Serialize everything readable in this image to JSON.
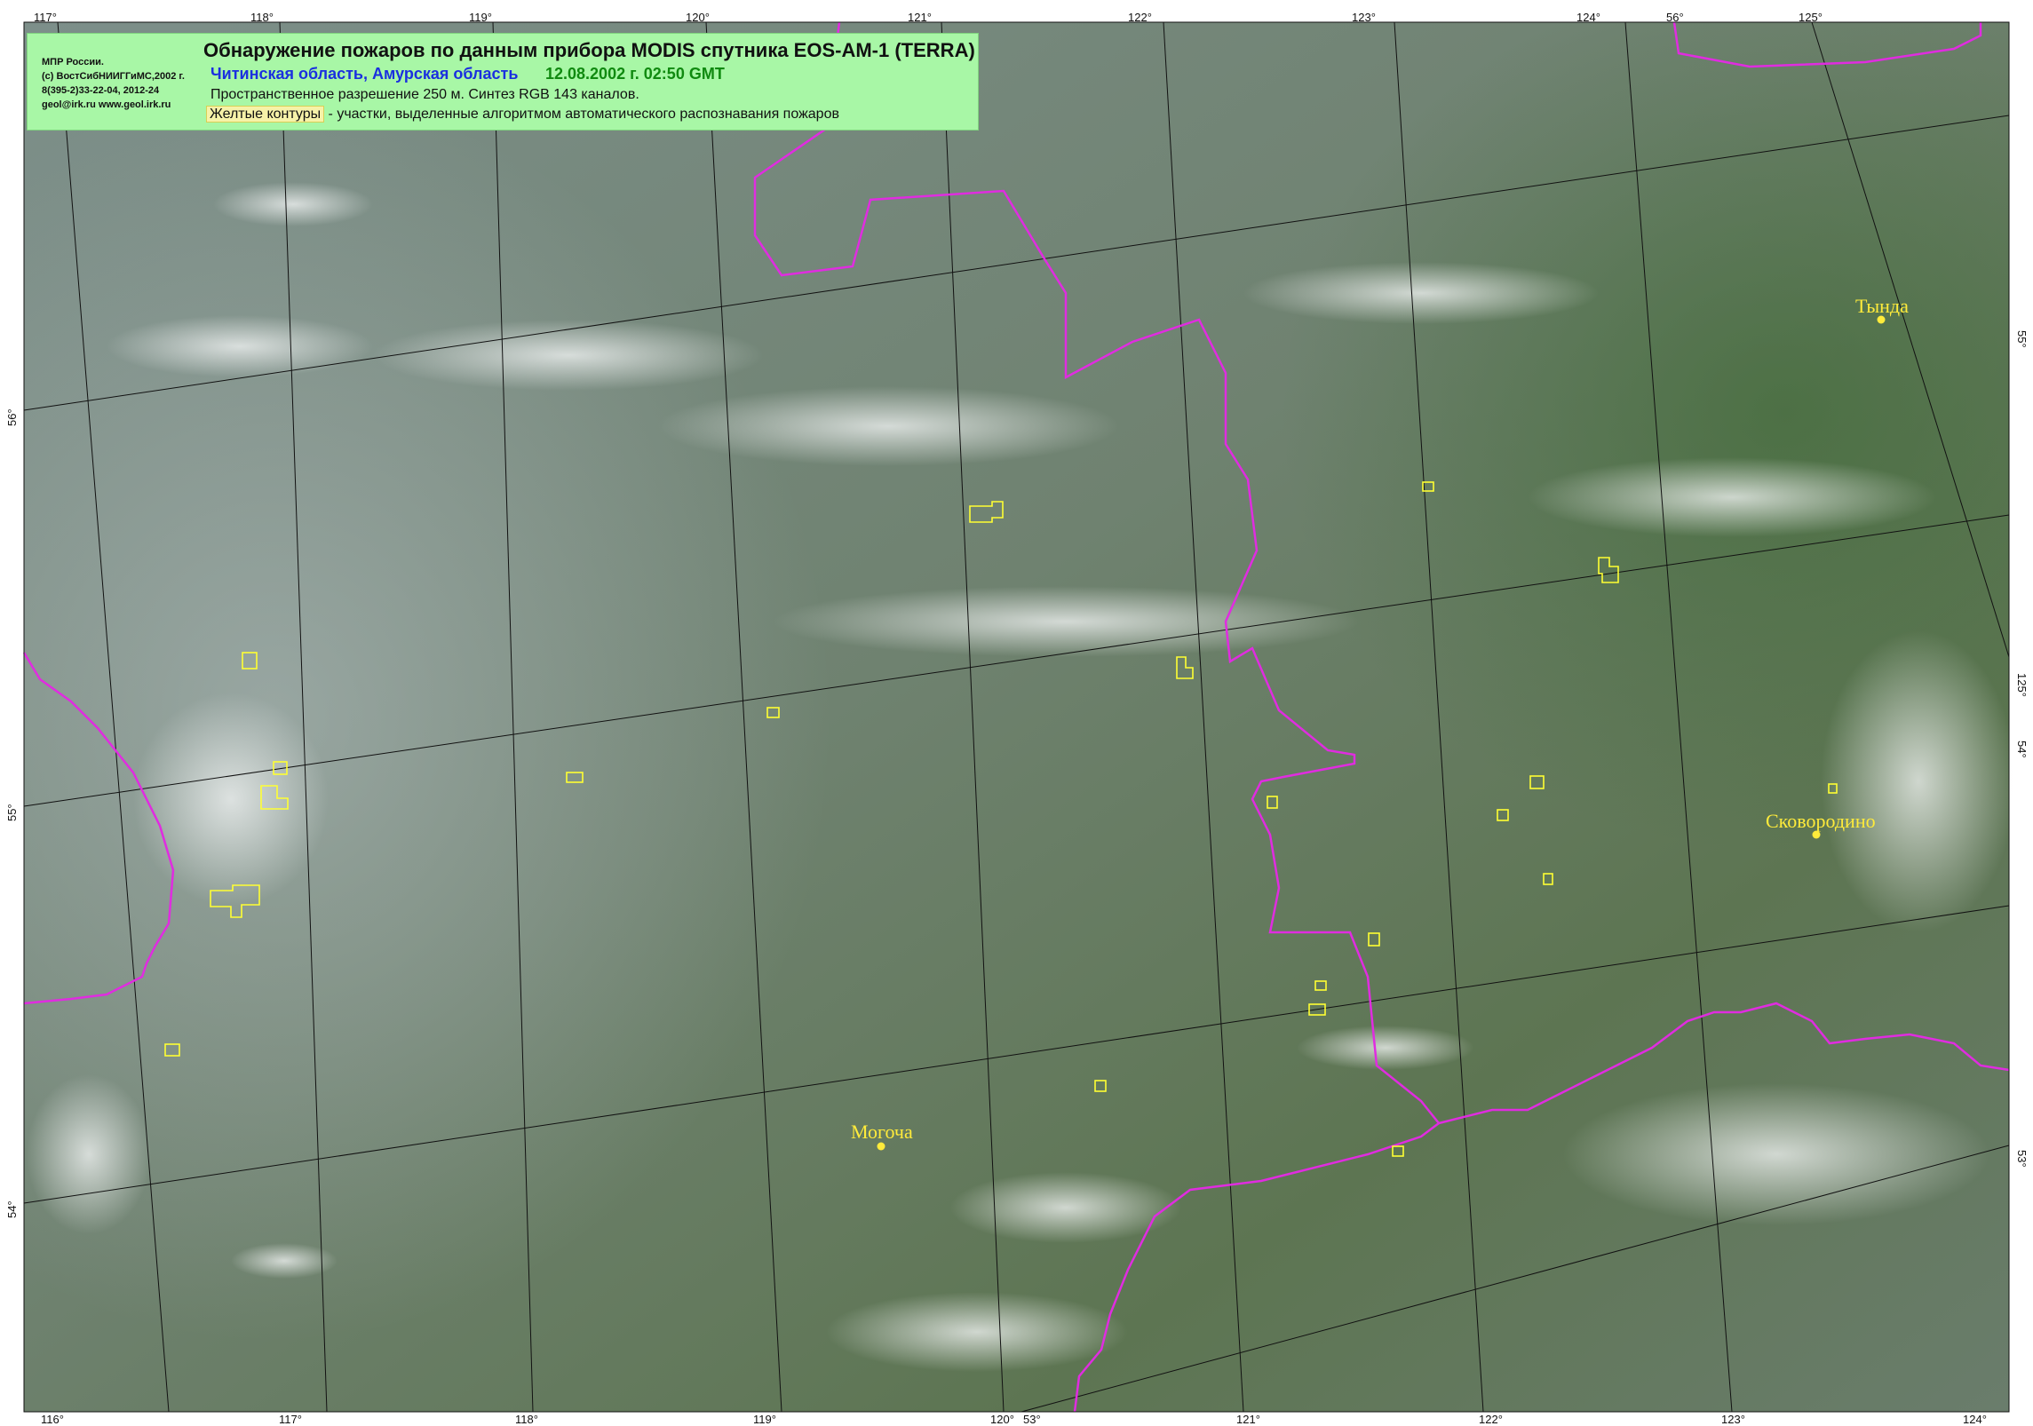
{
  "legend": {
    "org_lines": [
      "МПР России.",
      "(с) ВостСибНИИГГиМС,2002 г.",
      "8(395-2)33-22-04, 2012-24",
      "geol@irk.ru  www.geol.irk.ru"
    ],
    "title": "Обнаружение пожаров по данным прибора MODIS спутника EOS-AM-1 (TERRA)",
    "region": "Читинская область, Амурская область",
    "date": "12.08.2002 г. 02:50 GMT",
    "resolution": "Пространственное разрешение 250 м. Синтез RGB 143 каналов.",
    "contours_label": "Желтые контуры",
    "contours_text": " - участки, выделенные алгоритмом автоматического распознавания пожаров"
  },
  "ticks_top": [
    "117°",
    "118°",
    "119°",
    "120°",
    "121°",
    "122°",
    "123°",
    "124°",
    "56°",
    "125°"
  ],
  "ticks_bottom": [
    "116°",
    "117°",
    "118°",
    "119°",
    "120°",
    "53°",
    "121°",
    "122°",
    "123°",
    "124°"
  ],
  "ticks_left": [
    "56°",
    "55°",
    "54°"
  ],
  "ticks_right": [
    "55°",
    "125°",
    "54°",
    "53°"
  ],
  "towns": [
    "Тында",
    "Сковородино",
    "Могоча"
  ],
  "colors": {
    "border": "#e02ce0",
    "fire_contour": "#ffff33",
    "town": "#ffeb3b",
    "legend_bg": "#a8f7a6"
  }
}
